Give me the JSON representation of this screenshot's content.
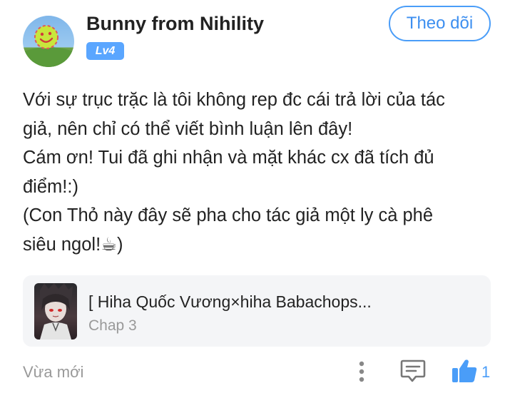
{
  "user": {
    "name": "Bunny from Nihility",
    "level": "Lv4",
    "follow_label": "Theo dõi"
  },
  "comment": {
    "lines": [
      "Với sự trục trặc là tôi không rep đc cái trả lời của tác",
      "giả, nên chỉ có thể viết bình luận lên đây!",
      "Cám ơn! Tui đã ghi nhận và mặt khác cx đã tích đủ",
      "điểm!:)",
      "(Con Thỏ này đây sẽ pha cho tác giả một ly cà phê",
      "siêu ngol!☕)"
    ]
  },
  "story": {
    "title": "[ Hiha Quốc Vương×hiha Babachops...",
    "chapter": "Chap 3"
  },
  "footer": {
    "timestamp": "Vừa mới",
    "like_count": "1"
  },
  "icons": {
    "more": "more-vertical-icon",
    "reply": "comment-icon",
    "like": "thumbs-up-icon"
  },
  "colors": {
    "accent": "#4a9df8",
    "level_badge": "#5aa6ff",
    "muted_text": "#999999",
    "card_background": "#f4f5f7"
  }
}
